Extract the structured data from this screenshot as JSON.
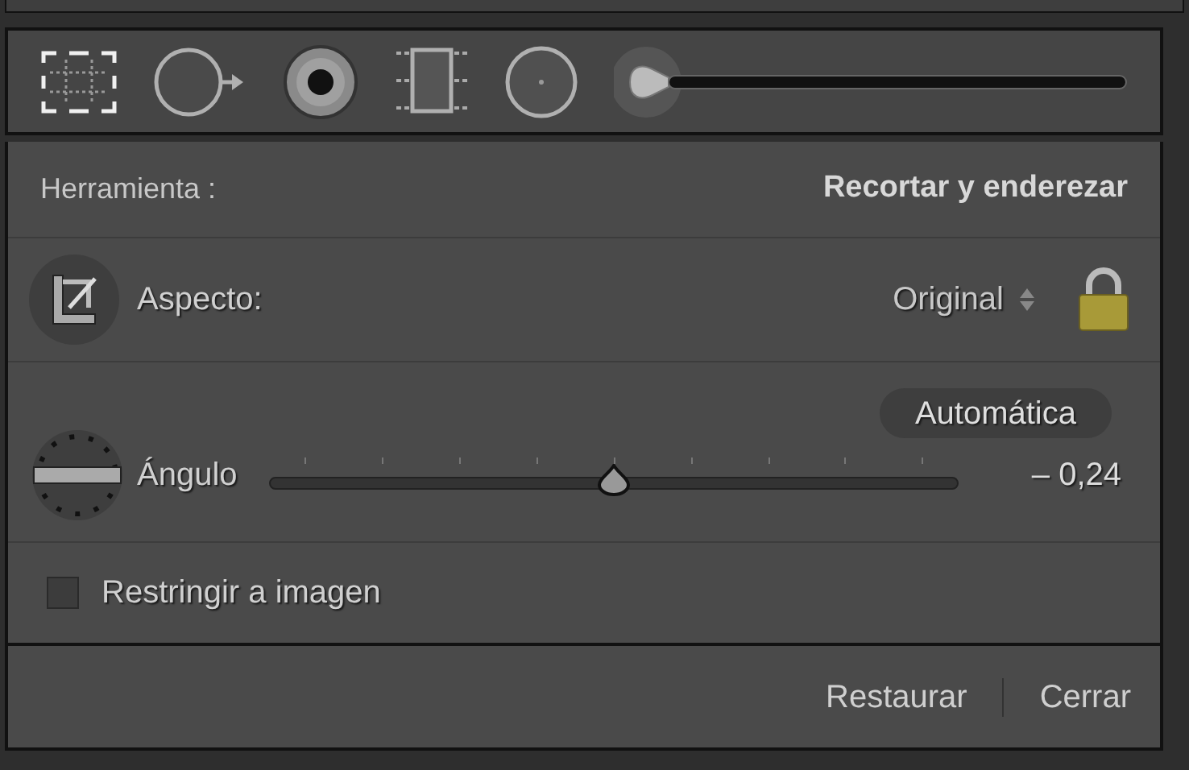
{
  "toolbar": {
    "tools": [
      {
        "kind": "crop",
        "selected": true
      },
      {
        "kind": "spot",
        "selected": false
      },
      {
        "kind": "redeye",
        "selected": false
      },
      {
        "kind": "graduated",
        "selected": false
      },
      {
        "kind": "radial",
        "selected": false
      },
      {
        "kind": "brush",
        "selected": false
      }
    ]
  },
  "tool_row": {
    "label": "Herramienta :",
    "value": "Recortar y enderezar"
  },
  "aspect": {
    "label": "Aspecto:",
    "value": "Original",
    "locked": true
  },
  "angle": {
    "auto_button": "Automática",
    "label": "Ángulo",
    "level": 0.5,
    "reading": "– 0,24"
  },
  "constrain": {
    "label": "Restringir a imagen",
    "checked": false
  },
  "footer": {
    "buttons": [
      "Restaurar",
      "Cerrar"
    ]
  }
}
